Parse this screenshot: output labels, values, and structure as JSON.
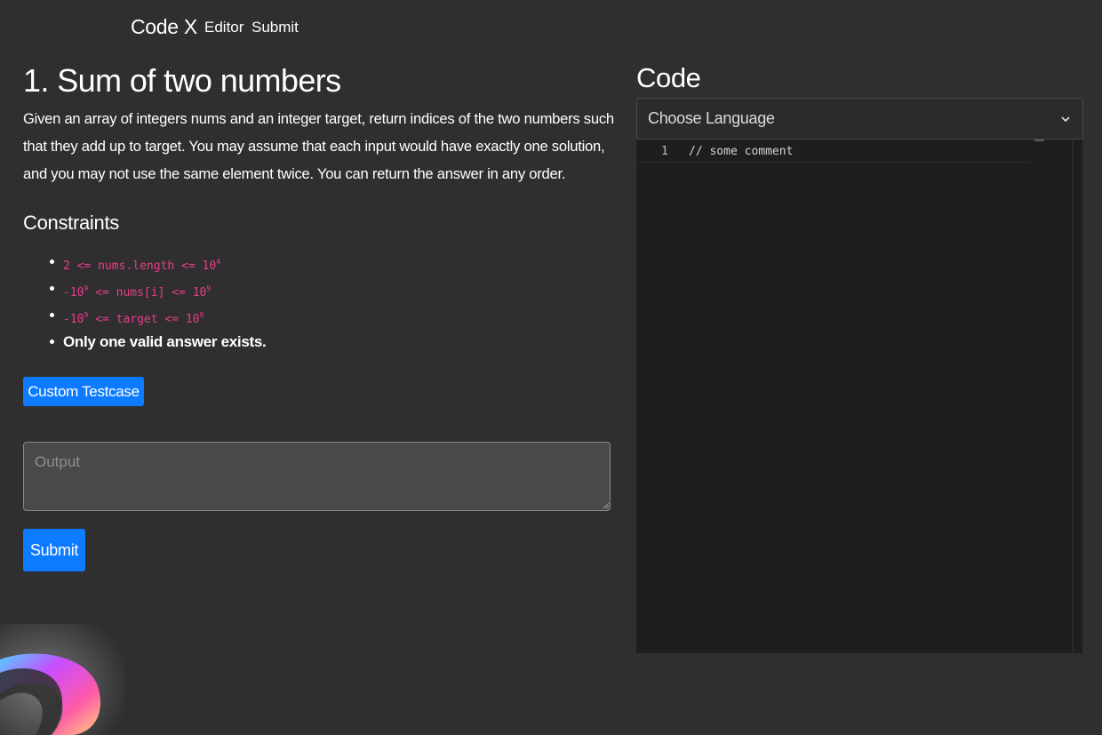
{
  "navbar": {
    "brand": "Code X",
    "links": [
      {
        "label": "Editor"
      },
      {
        "label": "Submit"
      }
    ]
  },
  "problem": {
    "title": "1. Sum of two numbers",
    "description": "Given an array of integers nums and an integer target, return indices of the two numbers such that they add up to target. You may assume that each input would have exactly one solution, and you may not use the same element twice. You can return the answer in any order.",
    "constraints_title": "Constraints",
    "constraints": [
      {
        "pre": "2 <= nums.length <= 10",
        "sup": "4"
      },
      {
        "pre": "-10",
        "sup1": "9",
        "mid": " <= nums[i] <= 10",
        "sup2": "9"
      },
      {
        "pre": "-10",
        "sup1": "9",
        "mid": " <= target <= 10",
        "sup2": "9"
      },
      {
        "text": "Only one valid answer exists."
      }
    ]
  },
  "actions": {
    "custom_testcase_label": "Custom Testcase",
    "output_placeholder": "Output",
    "output_value": "",
    "submit_label": "Submit"
  },
  "code_panel": {
    "heading": "Code",
    "language_select": {
      "selected": "Choose Language"
    },
    "editor": {
      "lines": [
        {
          "number": "1",
          "code": "// some comment"
        }
      ]
    }
  },
  "icons": {
    "select": "chevron-down-icon",
    "decoration": "gradient-blob-icon"
  },
  "colors": {
    "background": "#2f2f2f",
    "primary_button": "#0d7bff",
    "code_pink": "#e83e8c",
    "editor_background": "#1e1e1e"
  }
}
